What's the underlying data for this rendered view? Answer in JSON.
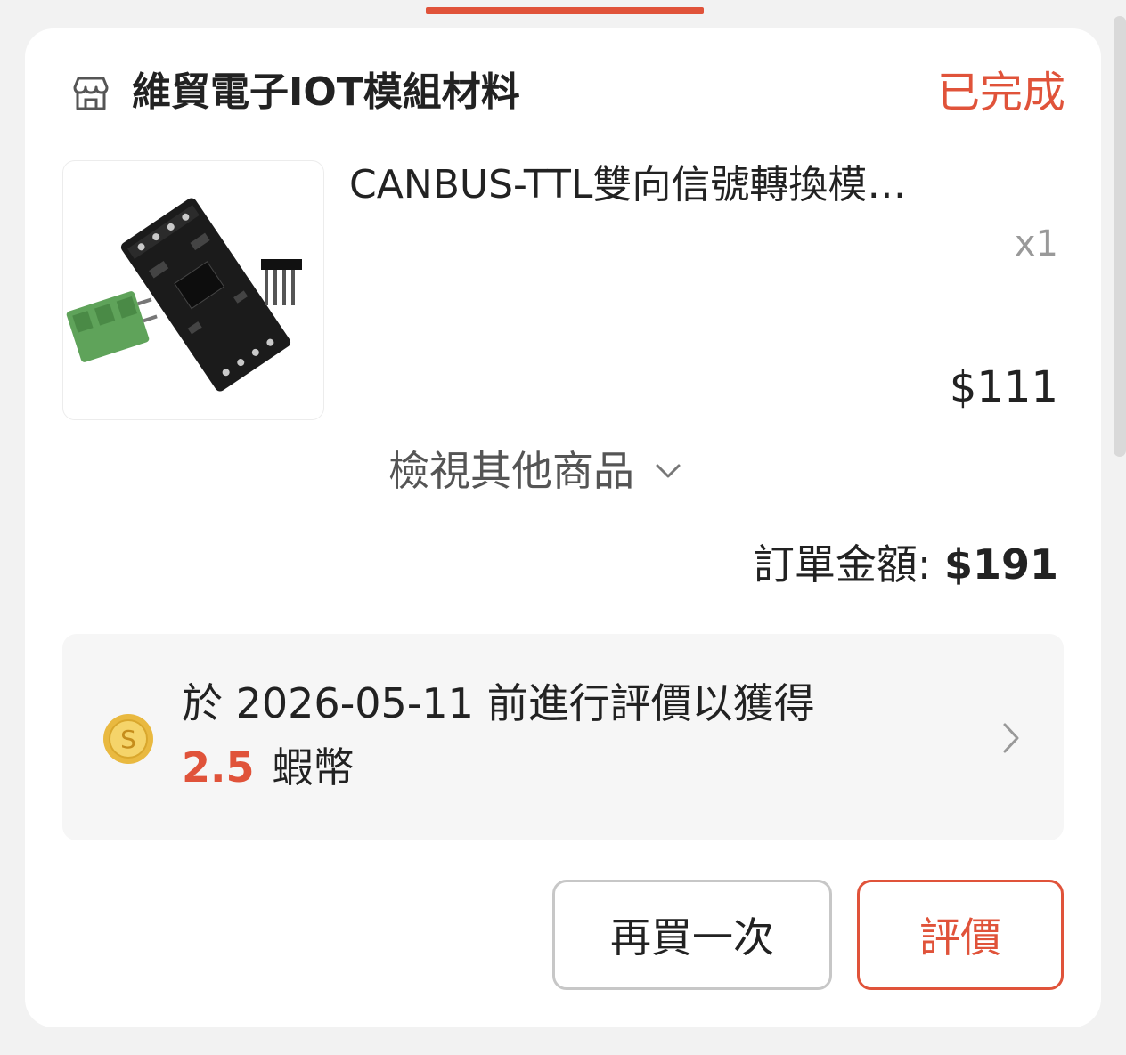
{
  "theme": {
    "accent": "#e0533a",
    "muted": "#999999",
    "card_bg": "#ffffff",
    "page_bg": "#f2f2f2"
  },
  "shop": {
    "icon": "shop-icon",
    "name": "維貿電子IOT模組材料",
    "status": "已完成"
  },
  "product": {
    "title": "CANBUS-TTL雙向信號轉換模…",
    "quantity": "x1",
    "price": "$111",
    "image_icon": "canbus-module-thumbnail"
  },
  "view_more": {
    "label": "檢視其他商品",
    "icon": "chevron-down-icon"
  },
  "order_total": {
    "label": "訂單金額: ",
    "amount": "$191"
  },
  "review_reward": {
    "icon": "coin-icon",
    "line1": "於 2026-05-11 前進行評價以獲得",
    "coins": "2.5",
    "coins_unit": "蝦幣",
    "arrow_icon": "chevron-right-icon"
  },
  "actions": {
    "rebuy_label": "再買一次",
    "review_label": "評價"
  }
}
